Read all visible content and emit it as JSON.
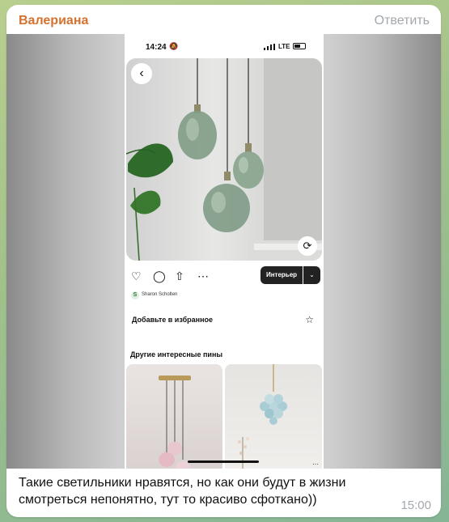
{
  "message": {
    "sender": "Валериана",
    "reply_label": "Ответить",
    "caption": "Такие светильники нравятся, но как они будут в жизни смотреться непонятно, тут то красиво сфоткано))",
    "time": "15:00",
    "sender_color": "#d4722e"
  },
  "phone": {
    "status": {
      "time": "14:24",
      "network": "LTE"
    },
    "board_button": "Интерьер",
    "author": {
      "initial": "S",
      "name": "Sharon Scholten"
    },
    "favorites_label": "Добавьте в избранное",
    "more_pins_title": "Другие интересные пины",
    "icons": [
      "back-icon",
      "visual-search-icon",
      "heart-icon",
      "comment-icon",
      "share-icon",
      "more-icon",
      "chevron-down-icon",
      "star-icon"
    ]
  }
}
